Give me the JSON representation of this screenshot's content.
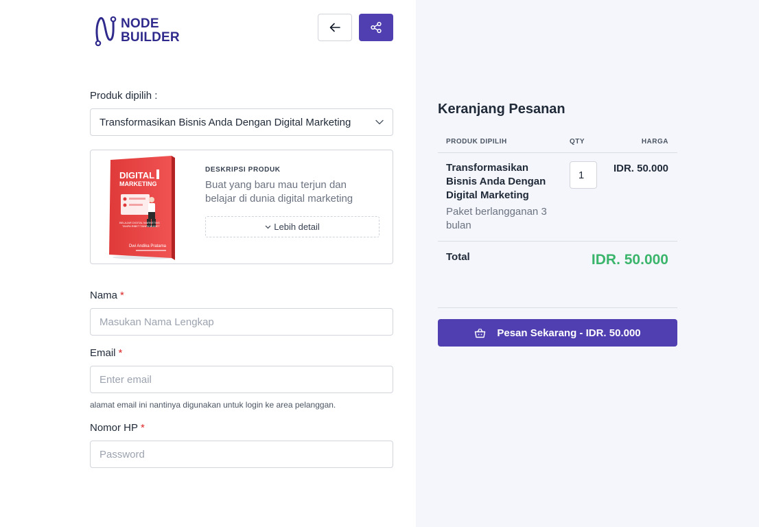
{
  "brand": {
    "line1": "NODE",
    "line2": "BUILDER"
  },
  "header": {
    "back_icon": "arrow-left-icon",
    "share_icon": "share-icon"
  },
  "colors": {
    "primary": "#4f3fb0",
    "brand_text": "#2f2a8c",
    "total": "#3bb56b",
    "required": "#dc2626",
    "right_panel_bg": "#f4f6fb"
  },
  "form": {
    "product_label": "Produk dipilih :",
    "product_selected": "Transformasikan Bisnis Anda Dengan Digital Marketing",
    "product_card": {
      "cover": {
        "title1": "DIGITAL",
        "title2": "MARKETING",
        "subtitle1": "BELAJAR DIGITAL MARKETING",
        "subtitle2": "TANPA RIBET TANPA MUMET",
        "author": "Dwi Andika Pratama"
      },
      "desc_title": "DESKRIPSI PRODUK",
      "desc_text": "Buat yang baru mau terjun dan belajar di dunia digital marketing",
      "more_label": "Lebih detail"
    },
    "name_label": "Nama",
    "name_placeholder": "Masukan Nama Lengkap",
    "email_label": "Email",
    "email_placeholder": "Enter email",
    "email_hint": "alamat email ini nantinya digunakan untuk login ke area pelanggan.",
    "phone_label": "Nomor HP",
    "phone_placeholder": "Password",
    "required_mark": "*"
  },
  "cart": {
    "title": "Keranjang Pesanan",
    "col_product": "PRODUK DIPILIH",
    "col_qty": "QTY",
    "col_price": "HARGA",
    "item_name": "Transformasikan Bisnis Anda Dengan Digital Marketing",
    "item_sub": "Paket berlangganan 3 bulan",
    "item_qty": "1",
    "item_price": "IDR. 50.000",
    "total_label": "Total",
    "total_value": "IDR. 50.000",
    "order_button": "Pesan Sekarang - IDR. 50.000",
    "order_icon": "basket-icon"
  }
}
